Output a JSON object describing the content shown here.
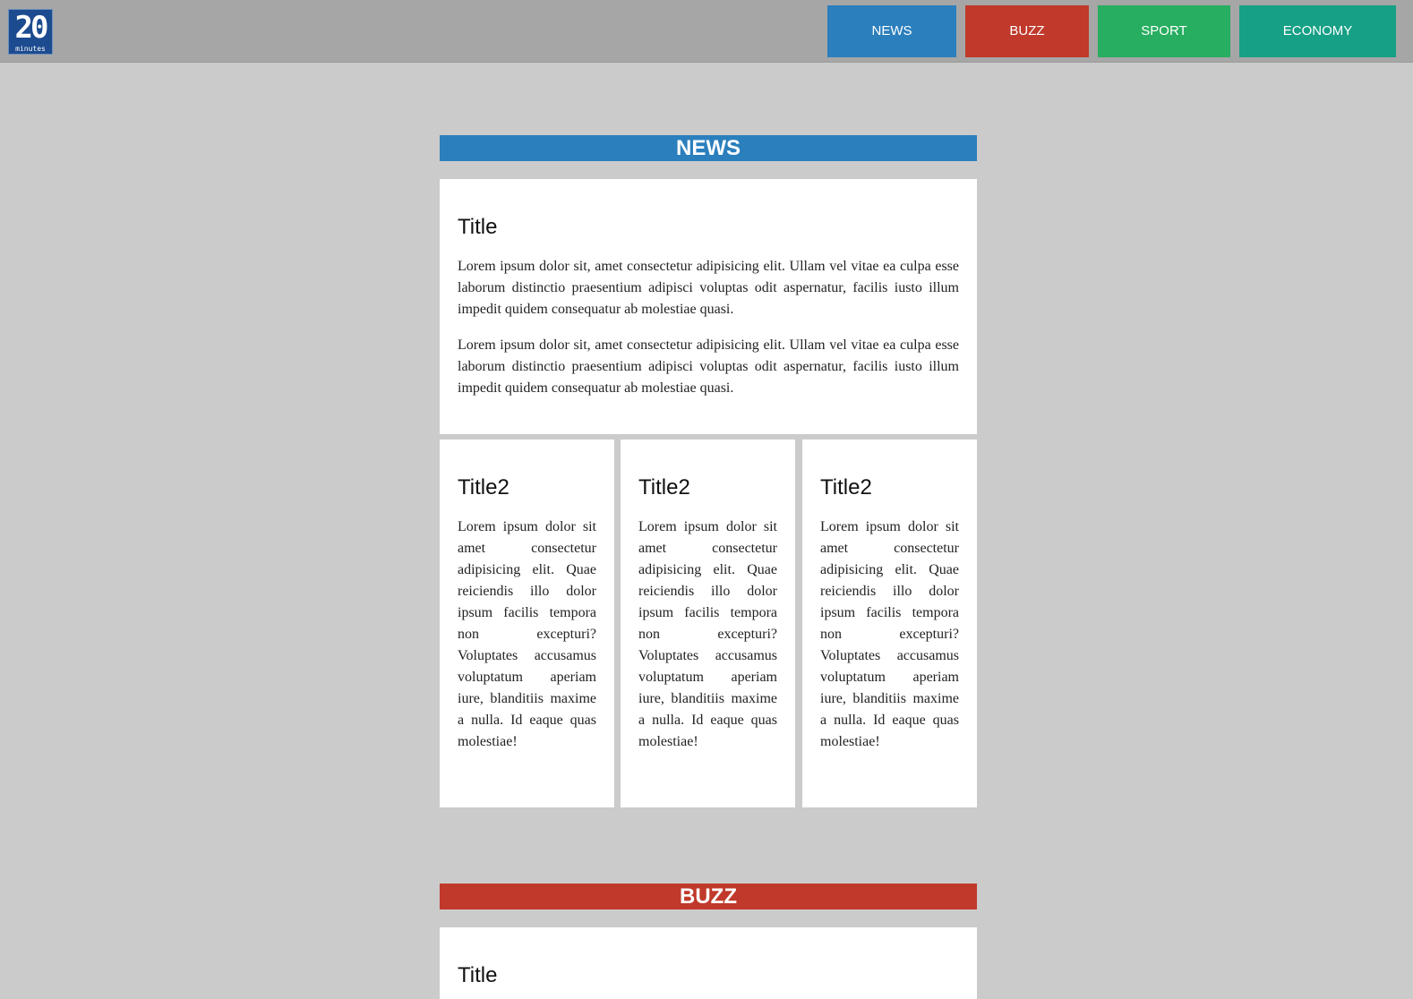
{
  "header": {
    "logo": {
      "number": "20",
      "word": "minutes",
      "color": "#1c4b8f"
    },
    "nav": [
      {
        "label": "NEWS",
        "color": "#2b7fbd"
      },
      {
        "label": "BUZZ",
        "color": "#c0392b"
      },
      {
        "label": "SPORT",
        "color": "#27ae60"
      },
      {
        "label": "ECONOMY",
        "color": "#16a085"
      }
    ]
  },
  "sections": {
    "news": {
      "heading": "NEWS",
      "color": "#2b7fbd",
      "main_article": {
        "title": "Title",
        "paragraphs": [
          "Lorem ipsum dolor sit, amet consectetur adipisicing elit. Ullam vel vitae ea culpa esse laborum distinctio praesentium adipisci voluptas odit aspernatur, facilis iusto illum impedit quidem consequatur ab molestiae quasi.",
          "Lorem ipsum dolor sit, amet consectetur adipisicing elit. Ullam vel vitae ea culpa esse laborum distinctio praesentium adipisci voluptas odit aspernatur, facilis iusto illum impedit quidem consequatur ab molestiae quasi."
        ]
      },
      "sub_articles": [
        {
          "title": "Title2",
          "text": "Lorem ipsum dolor sit amet consectetur adipisicing elit. Quae reiciendis illo dolor ipsum facilis tempora non excepturi? Voluptates accusamus voluptatum aperiam iure, blanditiis maxime a nulla. Id eaque quas molestiae!"
        },
        {
          "title": "Title2",
          "text": "Lorem ipsum dolor sit amet consectetur adipisicing elit. Quae reiciendis illo dolor ipsum facilis tempora non excepturi? Voluptates accusamus voluptatum aperiam iure, blanditiis maxime a nulla. Id eaque quas molestiae!"
        },
        {
          "title": "Title2",
          "text": "Lorem ipsum dolor sit amet consectetur adipisicing elit. Quae reiciendis illo dolor ipsum facilis tempora non excepturi? Voluptates accusamus voluptatum aperiam iure, blanditiis maxime a nulla. Id eaque quas molestiae!"
        }
      ]
    },
    "buzz": {
      "heading": "BUZZ",
      "color": "#c0392b",
      "main_article": {
        "title": "Title"
      }
    }
  }
}
